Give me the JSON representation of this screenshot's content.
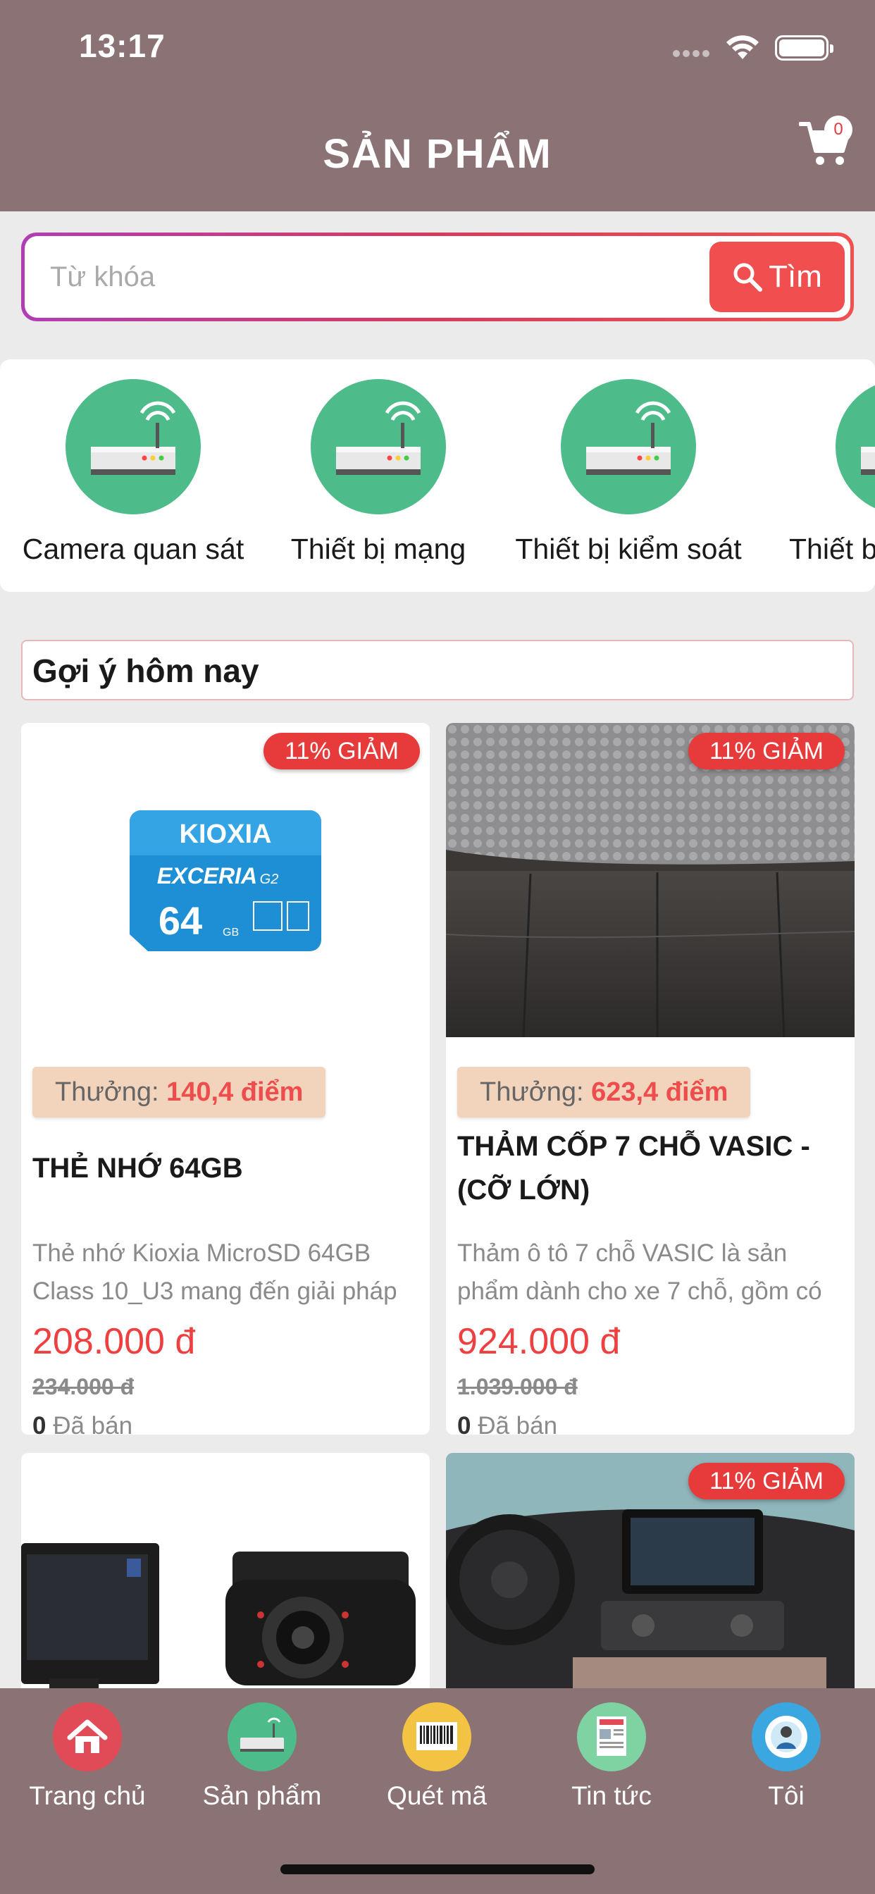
{
  "status_bar": {
    "time": "13:17"
  },
  "header": {
    "title": "SẢN PHẨM",
    "cart_count": "0"
  },
  "search": {
    "placeholder": "Từ khóa",
    "button_label": "Tìm"
  },
  "categories": [
    {
      "label": "Camera quan sát",
      "icon": "router-icon"
    },
    {
      "label": "Thiết bị mạng",
      "icon": "router-icon"
    },
    {
      "label": "Thiết bị kiểm soát",
      "icon": "router-icon"
    },
    {
      "label": "Thiết b",
      "icon": "router-icon"
    }
  ],
  "section": {
    "title": "Gợi ý hôm nay"
  },
  "products": [
    {
      "badge": "11% GIẢM",
      "reward_label": "Thưởng:",
      "reward_value": "140,4 điểm",
      "name": "THẺ NHỚ 64GB",
      "desc": "Thẻ nhớ Kioxia MicroSD 64GB Class 10_U3 mang đến giải pháp",
      "price": "208.000 đ",
      "old_price": "234.000 đ",
      "sold_count": "0",
      "sold_label": "Đã bán",
      "image": {
        "brand": "KIOXIA",
        "line": "EXCERIA",
        "gen": "G2",
        "capacity": "64",
        "unit": "GB"
      }
    },
    {
      "badge": "11% GIẢM",
      "reward_label": "Thưởng:",
      "reward_value": "623,4 điểm",
      "name": "THẢM CỐP 7 CHỖ VASIC - (CỠ LỚN)",
      "desc": "Thảm ô tô 7 chỗ VASIC là sản phẩm dành cho xe 7 chỗ, gồm có",
      "price": "924.000 đ",
      "old_price": "1.039.000 đ",
      "sold_count": "0",
      "sold_label": "Đã bán"
    },
    {
      "image_desc": "monitor-and-camera"
    },
    {
      "badge": "11% GIẢM",
      "image_desc": "car-interior"
    }
  ],
  "bottom_nav": [
    {
      "label": "Trang chủ",
      "icon": "home-icon",
      "color": "#e14b57"
    },
    {
      "label": "Sản phẩm",
      "icon": "router-icon",
      "color": "#4dbb8a"
    },
    {
      "label": "Quét mã",
      "icon": "barcode-icon",
      "color": "#f3c443"
    },
    {
      "label": "Tin tức",
      "icon": "news-icon",
      "color": "#7fd3a3"
    },
    {
      "label": "Tôi",
      "icon": "settings-user-icon",
      "color": "#3aa7e0"
    }
  ],
  "colors": {
    "header": "#8b7274",
    "accent": "#f14e4f",
    "category": "#4dbb8a"
  }
}
